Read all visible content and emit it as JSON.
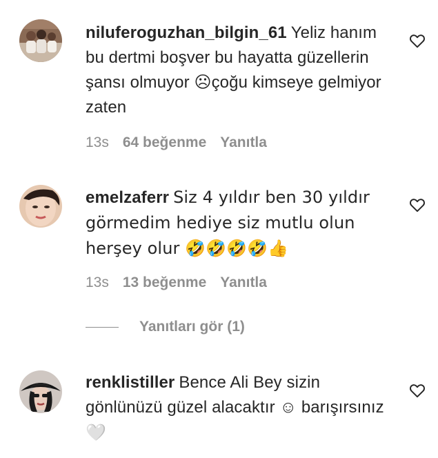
{
  "comments": [
    {
      "username": "niluferoguzhan_bilgin_61",
      "text": "Yeliz hanım bu dertmi boşver bu hayatta güzellerin şansı olmuyor ☹çoğu kimseye gelmiyor zaten",
      "time": "13s",
      "likes": "64 beğenme",
      "reply": "Yanıtla",
      "avatar_icon": "group-photo-avatar"
    },
    {
      "username": "emelzaferr",
      "text": "Siz 4 yıldır ben 30 yıldır görmedim hediye siz mutlu olun herşey olur 🤣🤣🤣🤣👍",
      "time": "13s",
      "likes": "13 beğenme",
      "reply": "Yanıtla",
      "avatar_icon": "portrait-avatar"
    },
    {
      "username": "renklistiller",
      "text": "Bence Ali Bey sizin gönlünüzü güzel alacaktır ☺ barışırsınız",
      "text_trailing": "🤍",
      "avatar_icon": "hat-portrait-avatar"
    }
  ],
  "view_replies": "Yanıtları gör (1)",
  "colors": {
    "text": "#262626",
    "secondary": "#8e8e8e"
  }
}
